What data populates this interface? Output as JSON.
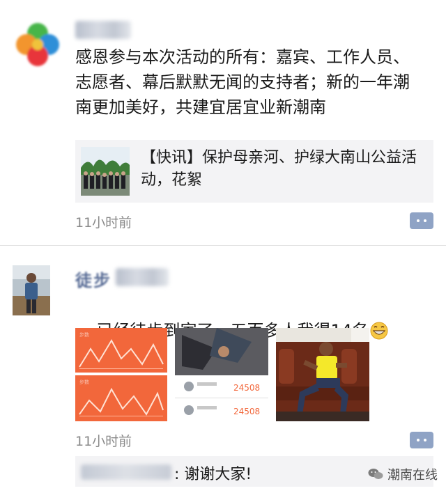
{
  "posts": [
    {
      "author_name": "",
      "text": "感恩参与本次活动的所有：嘉宾、工作人员、志愿者、幕后默默无闻的支持者；新的一年潮南更加美好，共建宜居宜业新潮南",
      "link_title": "【快讯】保护母亲河、护绿大南山公益活动，花絮",
      "timestamp": "11小时前"
    },
    {
      "author_name": "徒步",
      "text": "已经徒步到家了、五百多人我得14名",
      "emoji": "grinning-face-icon",
      "timestamp": "11小时前",
      "photos": [
        {
          "label": "step-chart-screenshot",
          "panel1_title": "步数",
          "panel2_title": "步数"
        },
        {
          "label": "ranking-screenshot",
          "rank_values": [
            "24508",
            "24508"
          ]
        },
        {
          "label": "man-sitting-photo"
        }
      ],
      "comment": {
        "text": ": 谢谢大家!"
      }
    }
  ],
  "watermark": "潮南在线",
  "colors": {
    "link_bg": "#f3f3f5",
    "name_blue": "#576b95",
    "timestamp_gray": "#8a8a8a",
    "comment_btn": "#8fa3c5",
    "step_orange": "#f2673b"
  }
}
